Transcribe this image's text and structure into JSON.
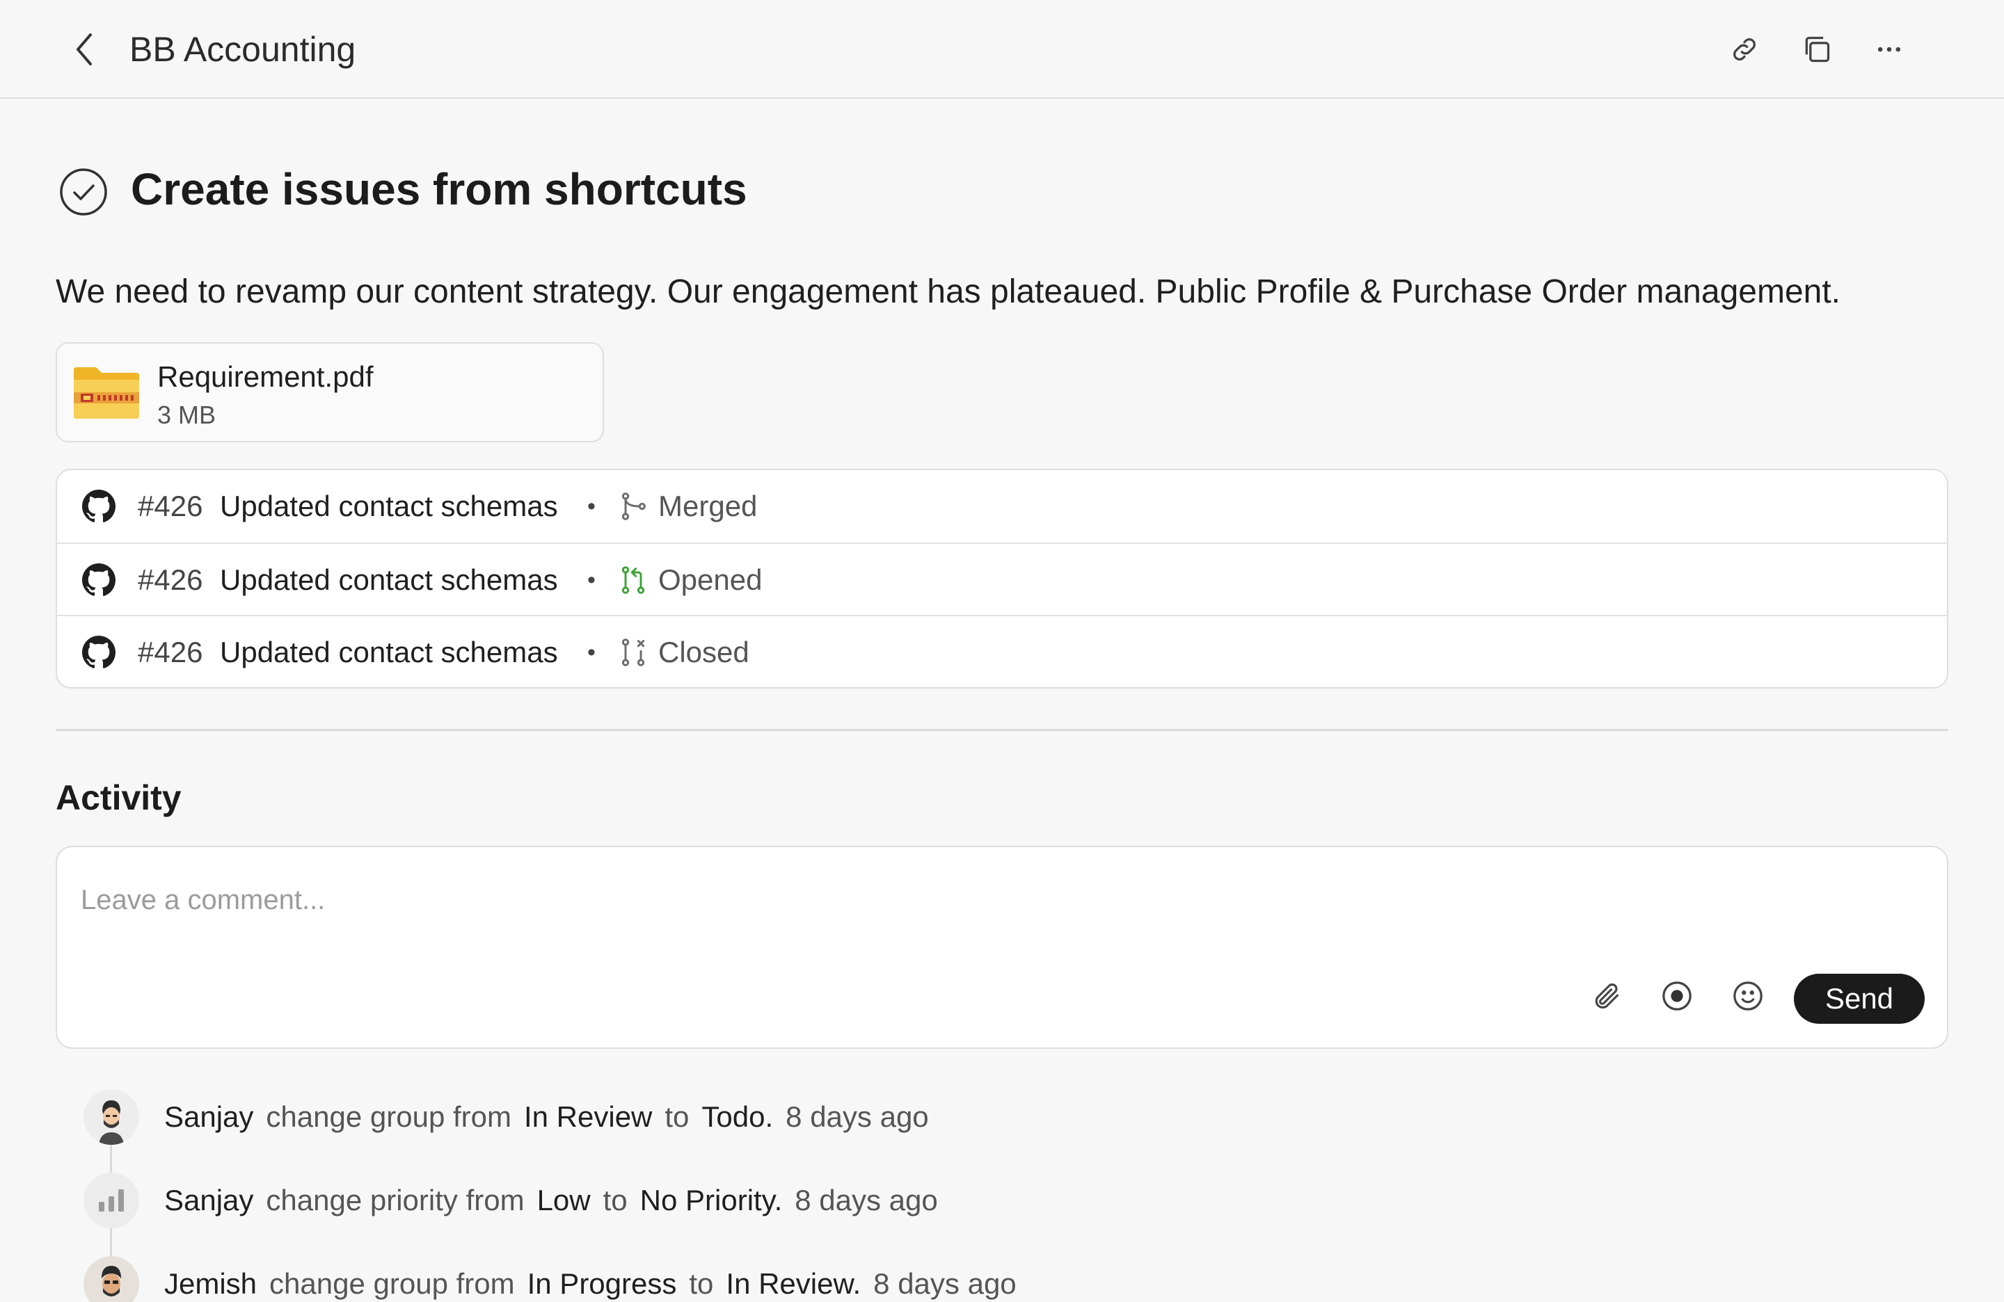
{
  "header": {
    "title": "BB Accounting",
    "icons": [
      "chevron-left-icon",
      "link-icon",
      "copy-icon",
      "more-horizontal-icon"
    ]
  },
  "issue": {
    "title": "Create issues from shortcuts",
    "status_icon": "check-circle-icon",
    "description": "We need to revamp our content strategy. Our engagement has plateaued. Public Profile & Purchase Order management."
  },
  "attachment": {
    "name": "Requirement.pdf",
    "size": "3 MB",
    "icon": "zip-folder-icon"
  },
  "pull_requests": [
    {
      "number": "#426",
      "title": "Updated contact schemas",
      "separator": "•",
      "status": "Merged",
      "status_icon": "git-merge-icon",
      "status_color": "#6b6b6b"
    },
    {
      "number": "#426",
      "title": "Updated contact schemas",
      "separator": "•",
      "status": "Opened",
      "status_icon": "git-pull-request-icon",
      "status_color": "#3aa334"
    },
    {
      "number": "#426",
      "title": "Updated contact schemas",
      "separator": "•",
      "status": "Closed",
      "status_icon": "git-pull-request-closed-icon",
      "status_color": "#6b6b6b"
    }
  ],
  "activity": {
    "title": "Activity",
    "comment_placeholder": "Leave a comment...",
    "send_label": "Send",
    "tool_icons": [
      "paperclip-icon",
      "record-icon",
      "smile-icon"
    ],
    "events": [
      {
        "user": "Sanjay",
        "action": "change group from",
        "from": "In Review",
        "to_word": "to",
        "to": "Todo.",
        "time": "8 days ago",
        "avatar": "avatar-sanjay"
      },
      {
        "user": "Sanjay",
        "action": "change priority from",
        "from": "Low",
        "to_word": "to",
        "to": "No Priority.",
        "time": "8 days ago",
        "avatar": "priority-bars-icon"
      },
      {
        "user": "Jemish",
        "action": "change group from",
        "from": "In Progress",
        "to_word": "to",
        "to": "In Review.",
        "time": "8 days ago",
        "avatar": "avatar-jemish"
      }
    ]
  },
  "colors": {
    "background": "#f7f7f7",
    "send_button": "#1b1b1b",
    "opened_green": "#3aa334",
    "folder_yellow": "#f5c542"
  }
}
